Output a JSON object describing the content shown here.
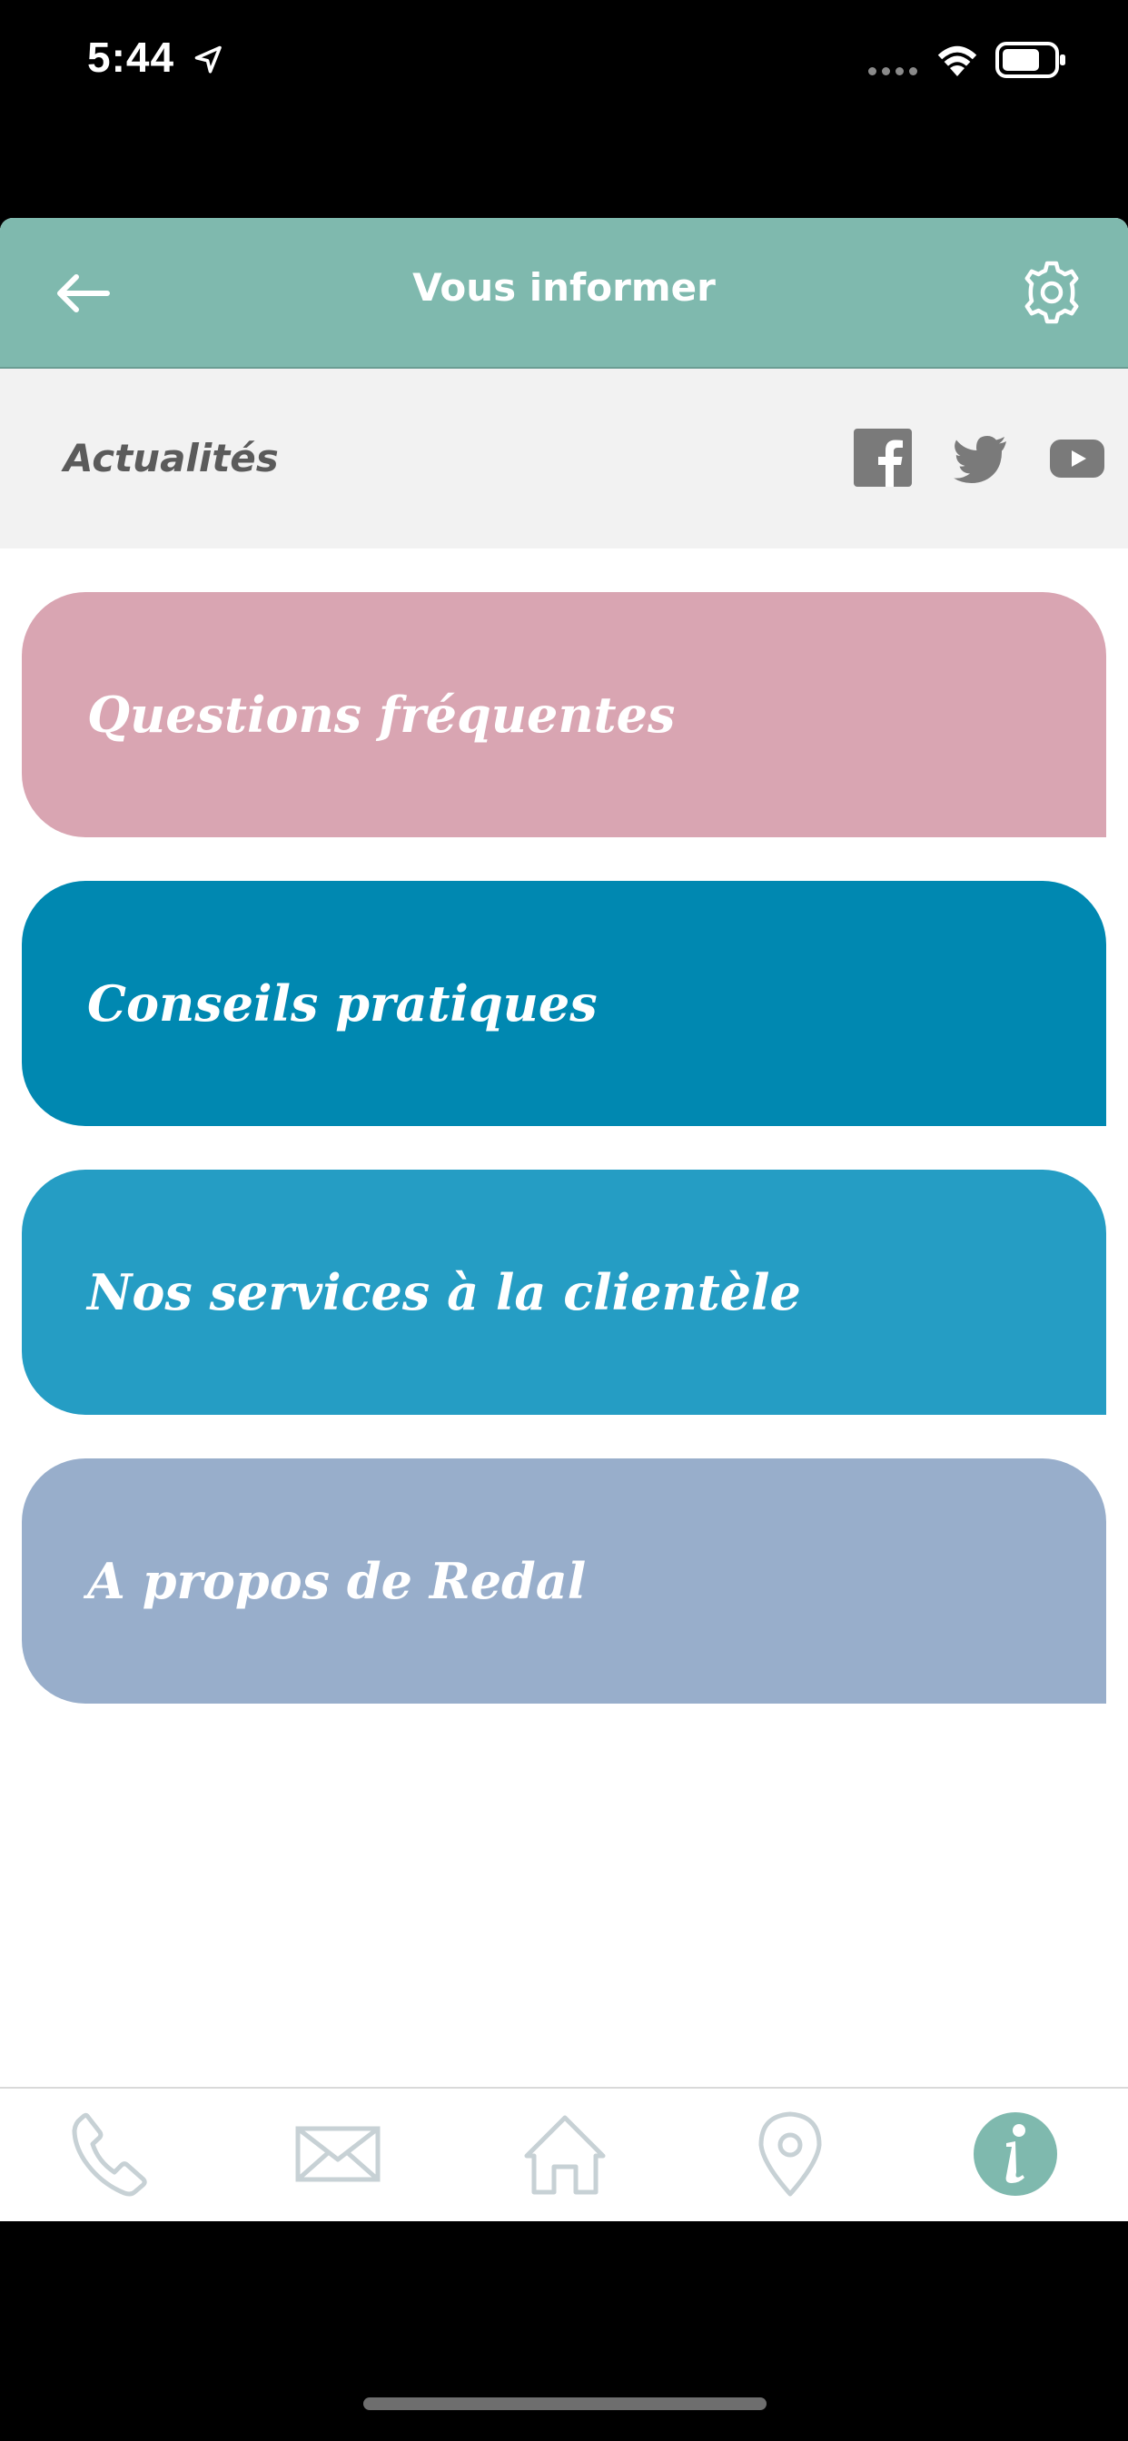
{
  "status_bar": {
    "time": "5:44"
  },
  "header": {
    "title": "Vous informer",
    "back_icon": "arrow-left-icon",
    "settings_icon": "gear-icon",
    "background_color": "#7fb9ae"
  },
  "news": {
    "label": "Actualités",
    "social": [
      "facebook-icon",
      "twitter-icon",
      "youtube-icon"
    ]
  },
  "cards": [
    {
      "label": "Questions fréquentes",
      "color": "#d9a5b2"
    },
    {
      "label": "Conseils pratiques",
      "color": "#0088b1"
    },
    {
      "label": "Nos services à la clientèle",
      "color": "#259dc4"
    },
    {
      "label": "A propos de Redal",
      "color": "#98aecb"
    }
  ],
  "tabbar": {
    "items": [
      "phone-icon",
      "mail-icon",
      "home-icon",
      "map-pin-icon",
      "info-icon"
    ],
    "active": "info-icon",
    "active_color": "#7fb9ae",
    "inactive_color": "#c7d1d5"
  }
}
